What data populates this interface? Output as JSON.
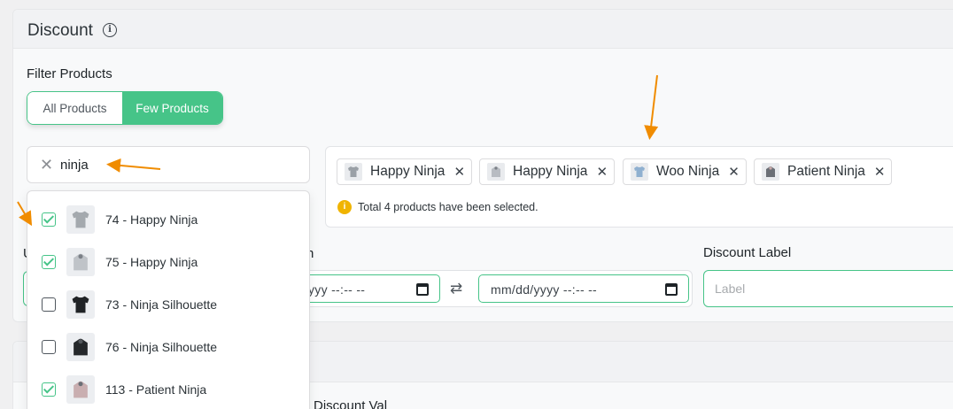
{
  "discount": {
    "title": "Discount",
    "filter_label": "Filter Products",
    "toggle": {
      "all": "All Products",
      "few": "Few Products",
      "selected": "few"
    },
    "search": {
      "value": "ninja"
    },
    "selected_chips": [
      {
        "label": "Happy Ninja",
        "shirt": "light"
      },
      {
        "label": "Happy Ninja",
        "shirt": "hoodie-light"
      },
      {
        "label": "Woo Ninja",
        "shirt": "blue"
      },
      {
        "label": "Patient Ninja",
        "shirt": "hoodie-dark"
      }
    ],
    "notice": "Total 4 products have been selected.",
    "dropdown_items": [
      {
        "label": "74 - Happy Ninja",
        "checked": true,
        "shirt": "light"
      },
      {
        "label": "75 - Happy Ninja",
        "checked": true,
        "shirt": "hoodie-light"
      },
      {
        "label": "73 - Ninja Silhouette",
        "checked": false,
        "shirt": "black"
      },
      {
        "label": "76 - Ninja Silhouette",
        "checked": false,
        "shirt": "hoodie-black"
      },
      {
        "label": "113 - Patient Ninja",
        "checked": true,
        "shirt": "hoodie-pink"
      }
    ],
    "left_label_partial": "U",
    "middle_label_partial": "n",
    "date_from": "yyy --:-- --",
    "date_to": "mm/dd/yyyy --:-- --",
    "discount_label": {
      "label": "Discount Label",
      "placeholder": "Label"
    },
    "bottom_partial_label": "Discount Val"
  },
  "colors": {
    "accent": "#46c488",
    "arrow": "#f08c00",
    "notice": "#f0b400"
  }
}
